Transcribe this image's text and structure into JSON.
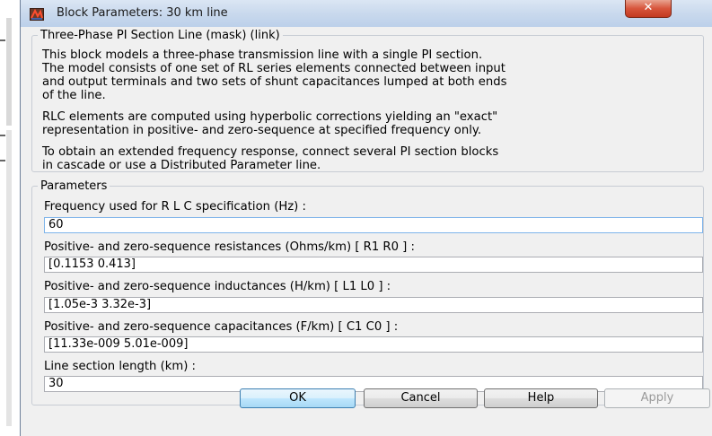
{
  "window": {
    "title": "Block Parameters: 30 km line",
    "close_glyph": "✕"
  },
  "description": {
    "legend": "Three-Phase PI Section Line (mask) (link)",
    "paragraphs": [
      [
        "This block models a three-phase transmission line with a single PI section.",
        "The model consists of one set of RL series elements connected between input",
        "and output terminals and two sets of shunt capacitances lumped at both ends",
        "of the line."
      ],
      [
        "RLC elements are computed using hyperbolic corrections yielding an \"exact\"",
        "representation in positive- and zero-sequence at specified frequency only."
      ],
      [
        "To obtain an extended frequency response, connect several PI section blocks",
        "in cascade or use a Distributed Parameter line."
      ]
    ]
  },
  "parameters": {
    "legend": "Parameters",
    "fields": [
      {
        "label": "Frequency used for R L C specification (Hz) :",
        "value": "60"
      },
      {
        "label": "Positive- and zero-sequence resistances (Ohms/km)  [ R1  R0 ] :",
        "value": "[0.1153 0.413]"
      },
      {
        "label": "Positive- and zero-sequence inductances (H/km) [ L1  L0 ] :",
        "value": "[1.05e-3 3.32e-3]"
      },
      {
        "label": "Positive- and zero-sequence capacitances (F/km)  [ C1 C0 ] :",
        "value": "[11.33e-009 5.01e-009]"
      },
      {
        "label": "Line section length (km) :",
        "value": "30"
      }
    ]
  },
  "buttons": {
    "ok": "OK",
    "cancel": "Cancel",
    "help": "Help",
    "apply": "Apply"
  },
  "icons": {
    "app": "simulink-block-icon",
    "close": "close-icon"
  },
  "colors": {
    "titlebar": "#c9d9ed",
    "close_button": "#d7553c",
    "dialog_background": "#f0f0f0",
    "focused_input_border": "#7eb4ea"
  }
}
